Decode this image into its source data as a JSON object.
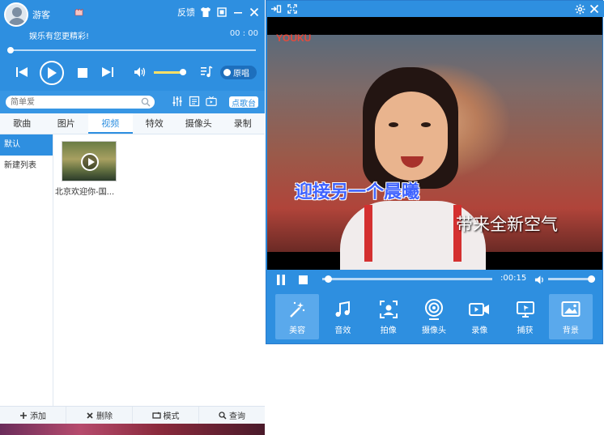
{
  "left_panel": {
    "header": {
      "username": "游客",
      "feedback_label": "反馈",
      "slogan": "娱乐有您更精彩!",
      "timecode": "00 : 00"
    },
    "controls": {
      "original_label": "原唱",
      "volume_fraction": 0.9,
      "progress_fraction": 0.0
    },
    "search": {
      "placeholder": "简单爱",
      "dd_label": "点歌台"
    },
    "tabs": [
      {
        "label": "歌曲"
      },
      {
        "label": "图片"
      },
      {
        "label": "视频"
      },
      {
        "label": "特效"
      },
      {
        "label": "摄像头"
      },
      {
        "label": "录制"
      }
    ],
    "active_tab": "视频",
    "playlists": [
      {
        "label": "默认"
      },
      {
        "label": "新建列表"
      }
    ],
    "media": [
      {
        "label": "北京欢迎你-国..."
      }
    ],
    "footer": {
      "add": "添加",
      "delete": "删除",
      "mode": "模式",
      "query": "查询"
    }
  },
  "right_panel": {
    "video": {
      "logo": "YOUKU",
      "subtitle_left": "迎接另一个晨曦",
      "subtitle_right": "带来全新空气"
    },
    "playback": {
      "time": ":00:15",
      "progress_fraction": 0.03,
      "volume_fraction": 0.9
    },
    "tools": [
      {
        "label": "美容",
        "icon": "magic-wand-icon"
      },
      {
        "label": "音效",
        "icon": "music-note-icon"
      },
      {
        "label": "拍像",
        "icon": "portrait-frame-icon"
      },
      {
        "label": "摄像头",
        "icon": "webcam-icon"
      },
      {
        "label": "录像",
        "icon": "video-record-icon"
      },
      {
        "label": "捕获",
        "icon": "screen-capture-icon"
      },
      {
        "label": "背景",
        "icon": "background-image-icon"
      }
    ]
  },
  "colors": {
    "primary": "#2e8fe0",
    "accent_volume": "#ffe066",
    "logo_red": "#e64a3b",
    "subtitle_blue": "#3f63ff"
  }
}
